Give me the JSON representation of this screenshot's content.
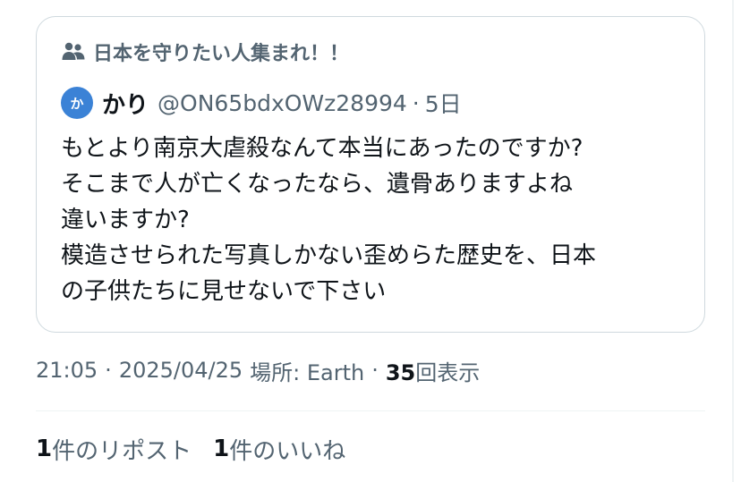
{
  "community": {
    "icon": "community-icon",
    "name": "日本を守りたい人集まれ！！"
  },
  "quoted_post": {
    "avatar_text": "か",
    "avatar_color": "#3b82d6",
    "display_name": "かり",
    "handle": "@ON65bdxOWz28994",
    "separator": "·",
    "time": "5日",
    "lines": [
      "もとより南京大虐殺なんて本当にあったのですか?",
      "そこまで人が亡くなったなら、遺骨ありますよね",
      "違いますか?",
      "模造させられた写真しかない歪めらた歴史を、日本",
      "の子供たちに見せないで下さい"
    ]
  },
  "meta": {
    "time": "21:05",
    "sep1": "·",
    "date": "2025/04/25",
    "location_label": "場所: Earth",
    "sep2": "·",
    "views_count": "35",
    "views_label": "回表示"
  },
  "stats": {
    "reposts_count": "1",
    "reposts_label": "件のリポスト",
    "likes_count": "1",
    "likes_label": "件のいいね"
  },
  "colors": {
    "secondary_text": "#536471",
    "primary_text": "#0f1419",
    "border": "#cfd9de"
  }
}
